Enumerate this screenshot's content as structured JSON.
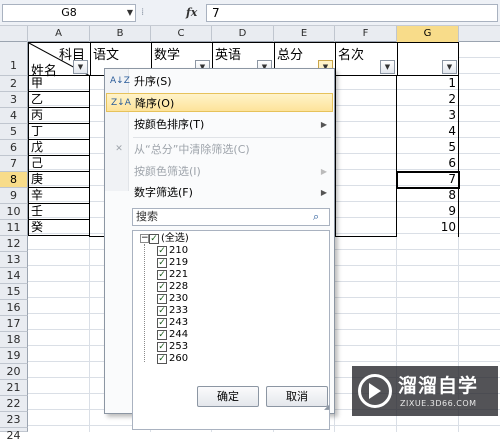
{
  "formula_bar": {
    "name_box": "G8",
    "name_box_arrow": "▼",
    "separator": "⁞",
    "fx": "fx",
    "formula": "7"
  },
  "columns": [
    "A",
    "B",
    "C",
    "D",
    "E",
    "F",
    "G"
  ],
  "rows": [
    "1",
    "2",
    "3",
    "4",
    "5",
    "6",
    "7",
    "8",
    "9",
    "10",
    "11",
    "12",
    "13",
    "14",
    "15",
    "16",
    "17",
    "18",
    "19",
    "20",
    "21",
    "22",
    "23",
    "24"
  ],
  "header_row": {
    "a_top": "科目",
    "a_bottom": "姓名",
    "b": "语文",
    "c": "数学",
    "d": "英语",
    "e": "总分",
    "f": "名次"
  },
  "names": [
    "甲",
    "乙",
    "丙",
    "丁",
    "戊",
    "己",
    "庚",
    "辛",
    "壬",
    "癸"
  ],
  "ranks": [
    "1",
    "2",
    "3",
    "4",
    "5",
    "6",
    "7",
    "8",
    "9",
    "10"
  ],
  "filter_menu": {
    "sort_asc": "升序(S)",
    "sort_desc": "降序(O)",
    "sort_by_color": "按颜色排序(T)",
    "clear_filter": "从“总分”中清除筛选(C)",
    "filter_by_color": "按颜色筛选(I)",
    "number_filters": "数字筛选(F)",
    "search_placeholder": "搜索",
    "values": [
      "(全选)",
      "210",
      "219",
      "221",
      "228",
      "230",
      "233",
      "243",
      "244",
      "253",
      "260"
    ],
    "ok": "确定",
    "cancel": "取消"
  },
  "icons": {
    "sort_asc": "A↓Z",
    "sort_desc": "Z↓A",
    "clear": "✕",
    "submenu_arrow": "▶",
    "filter_arrow": "▼",
    "search": "⌕",
    "check": "✓",
    "grip": "◢"
  },
  "watermark": {
    "title": "溜溜自学",
    "url": "ZIXUE.3D66.COM"
  },
  "colors": {
    "active_header": "#f8dc8a",
    "menu_hover": "#fde39a",
    "gridline": "#dadfe6"
  }
}
